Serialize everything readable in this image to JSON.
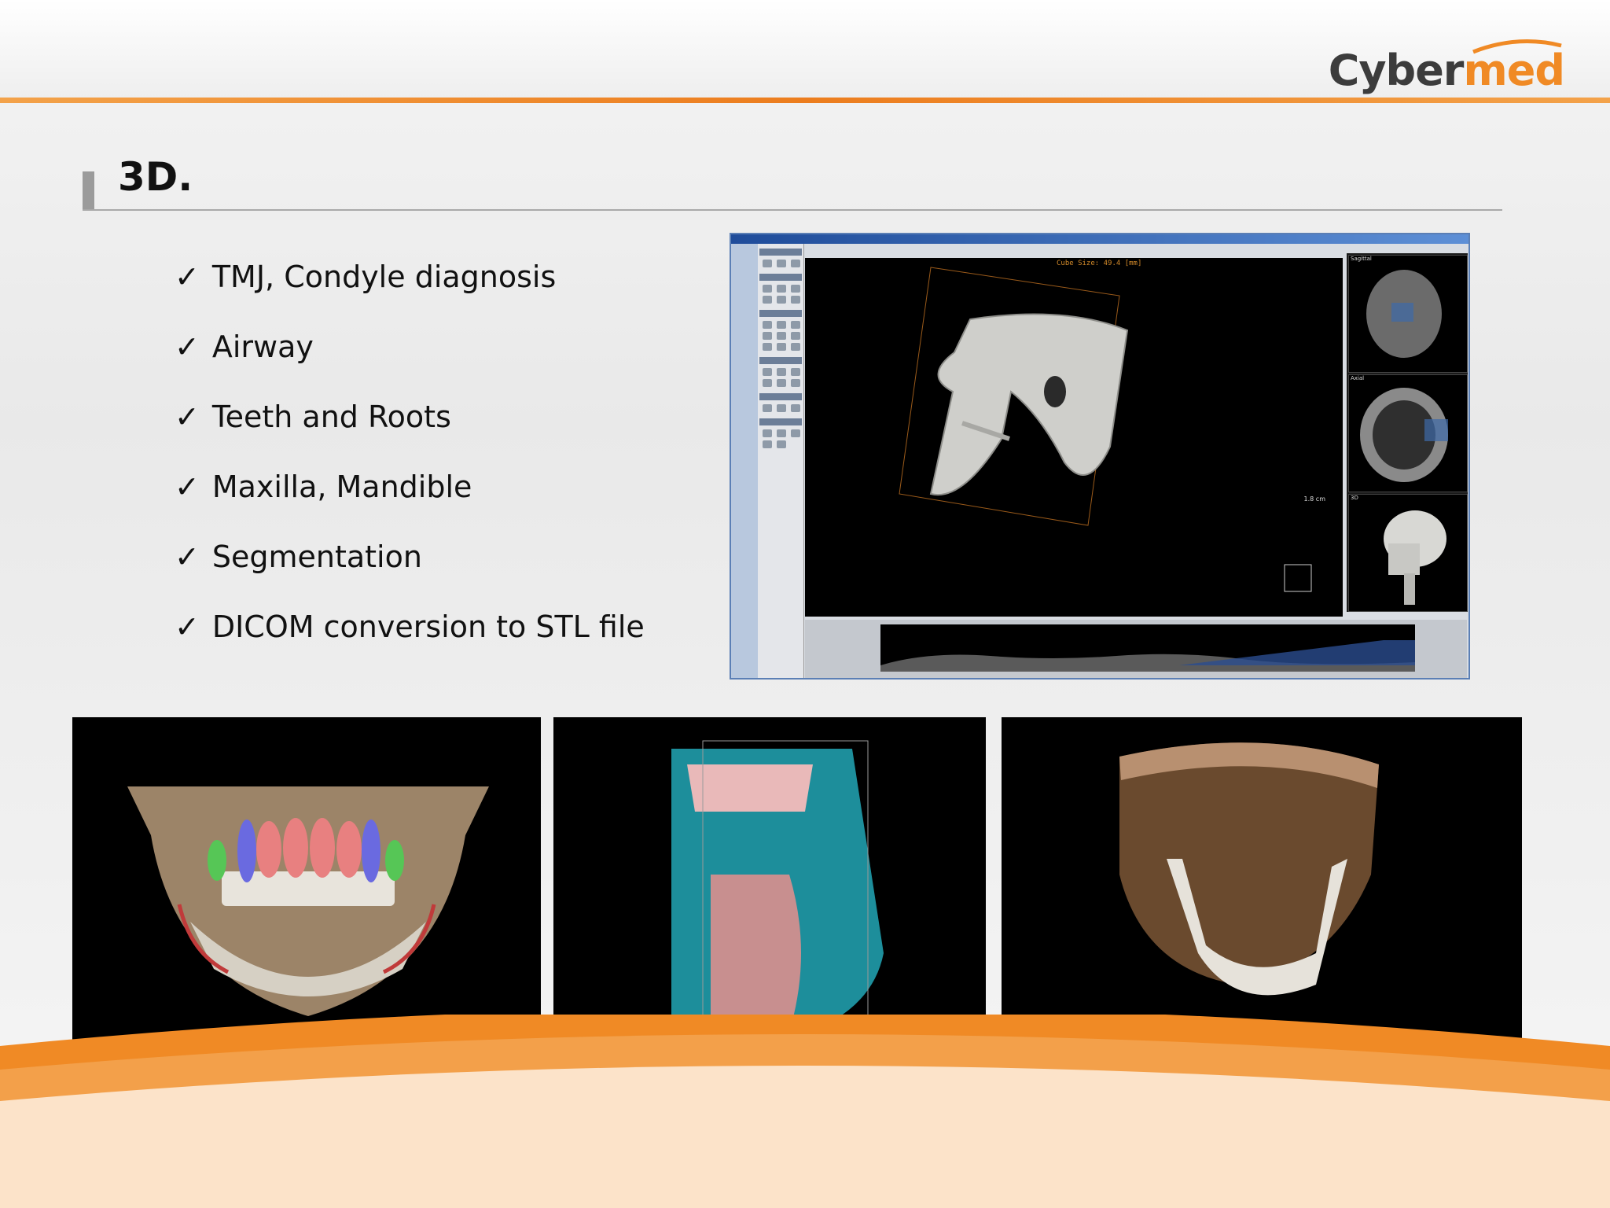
{
  "brand": {
    "logo_part1": "Cyber",
    "logo_part2": "med"
  },
  "slide": {
    "title": "3D."
  },
  "bullets": [
    {
      "check": "✓",
      "text": "TMJ, Condyle diagnosis"
    },
    {
      "check": "✓",
      "text": "Airway"
    },
    {
      "check": "✓",
      "text": "Teeth and Roots"
    },
    {
      "check": "✓",
      "text": "Maxilla, Mandible"
    },
    {
      "check": "✓",
      "text": "Segmentation"
    },
    {
      "check": "✓",
      "text": "DICOM conversion to STL file"
    }
  ],
  "software_screenshot": {
    "cube_size": "Cube Size: 49.4 [mm]",
    "scale_label": "1.8 cm",
    "side_labels": [
      "Sagittal",
      "Axial",
      "3D"
    ]
  },
  "colors": {
    "accent_orange": "#ec7d1e",
    "logo_gray": "#3c3c3c",
    "logo_orange": "#f08a25"
  }
}
